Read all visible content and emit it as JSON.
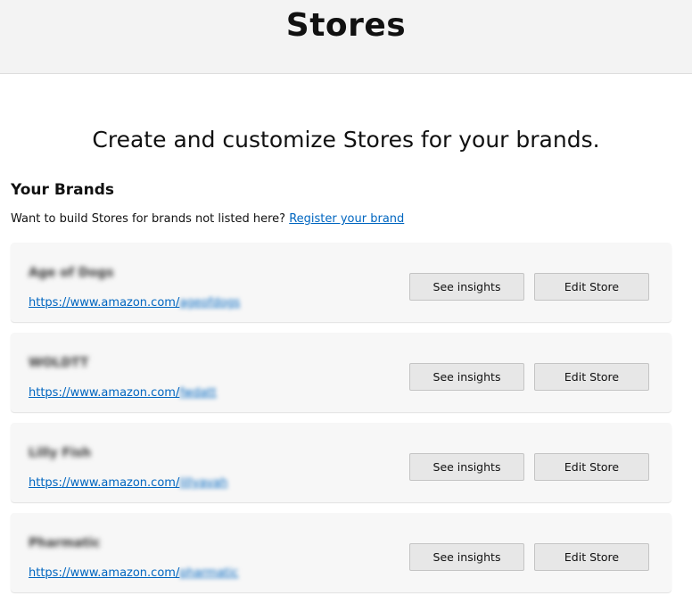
{
  "header": {
    "title": "Stores"
  },
  "main": {
    "subtitle": "Create and customize Stores for your brands.",
    "section_title": "Your Brands",
    "prompt_text": "Want to build Stores for brands not listed here? ",
    "register_link": "Register your brand"
  },
  "brands": [
    {
      "name": "Age of Dogs",
      "url_prefix": "https://www.amazon.com/",
      "url_slug": "ageofdogs",
      "insights_label": "See insights",
      "edit_label": "Edit Store"
    },
    {
      "name": "WOLDTT",
      "url_prefix": "https://www.amazon.com/",
      "url_slug": "fwdatt",
      "insights_label": "See insights",
      "edit_label": "Edit Store"
    },
    {
      "name": "Lilly Fish",
      "url_prefix": "https://www.amazon.com/",
      "url_slug": "lillyavah",
      "insights_label": "See insights",
      "edit_label": "Edit Store"
    },
    {
      "name": "Pharmatic",
      "url_prefix": "https://www.amazon.com/",
      "url_slug": "pharmatic",
      "insights_label": "See insights",
      "edit_label": "Edit Store"
    }
  ]
}
